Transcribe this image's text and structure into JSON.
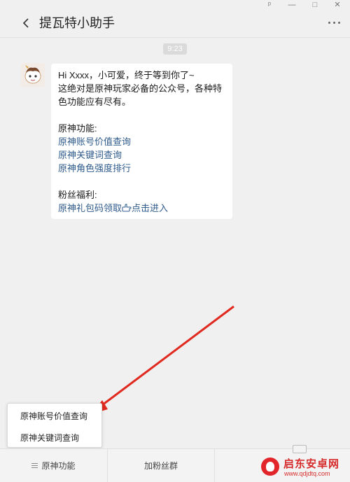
{
  "window": {
    "controls": {
      "pin": "ᵖ",
      "minimize": "—",
      "maximize": "□",
      "close": "✕"
    }
  },
  "header": {
    "title": "提瓦特小助手",
    "back_icon": "chevron-left-icon",
    "more_icon": "more-dots-icon"
  },
  "chat": {
    "timestamp": "9:23",
    "message": {
      "lines": [
        "Hi Xxxx，小可爱，终于等到你了~",
        "这绝对是原神玩家必备的公众号，各种特",
        "色功能应有尽有。"
      ],
      "section1_title": "原神功能:",
      "section1_links": [
        "原神账号价值查询",
        "原神关键词查询",
        "原神角色强度排行"
      ],
      "section2_title": "粉丝福利:",
      "section2_link_a": "原神礼包码领取",
      "section2_link_b": "点击进入"
    }
  },
  "popup_menu": {
    "items": [
      "原神账号价值查询",
      "原神关键词查询"
    ]
  },
  "bottom_menu": {
    "tabs": [
      "原神功能",
      "加粉丝群"
    ]
  },
  "watermark": {
    "name": "启东安卓网",
    "url": "www.qdjdtq.com"
  },
  "colors": {
    "link": "#2f5b8c",
    "arrow": "#e02a20",
    "background": "#f0f0f0",
    "watermark": "#d62b2b"
  }
}
